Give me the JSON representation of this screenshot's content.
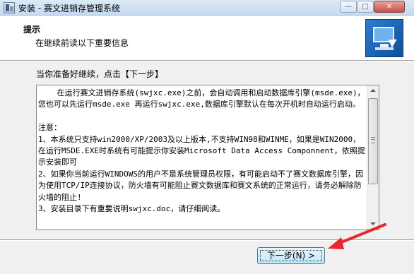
{
  "window": {
    "title": "安装 - 赛文进销存管理系统"
  },
  "header": {
    "title": "提示",
    "subtitle": "在继续前读以下重要信息"
  },
  "content": {
    "prompt": "当你准备好继续，点击【下一步】",
    "notes": "    在运行赛文进销存系统(swjxc.exe)之前，会自动调用和启动数据库引擎(msde.exe)，您也可以先运行msde.exe 再运行swjxc.exe,数据库引擎默认在每次开机时自动运行启动。\n\n注意：\n1、本系统只支持win2000/XP/2003及以上版本,不支持WIN98和WINME，如果是WIN2000，在运行MSDE.EXE时系统有可能提示你安装Microsoft Data Access Componnent，依照提示安装即可\n2、如果你当前运行WINDOWS的用户不是系统管理员权限，有可能启动不了赛文数据库引擎，因为使用TCP/IP连接协议，防火墙有可能阻止赛文数据库和赛文系统的正常运行，请务必解除防火墙的阻止!\n3、安装目录下有重要说明swjxc.doc，请仔细阅读。"
  },
  "footer": {
    "next_label": "下一步(N) >"
  },
  "colors": {
    "annotation_arrow": "#e8262c",
    "content_background": "#f0f0f0"
  },
  "icons": {
    "app": "installer-icon",
    "header_image": "computer-setup-icon"
  }
}
